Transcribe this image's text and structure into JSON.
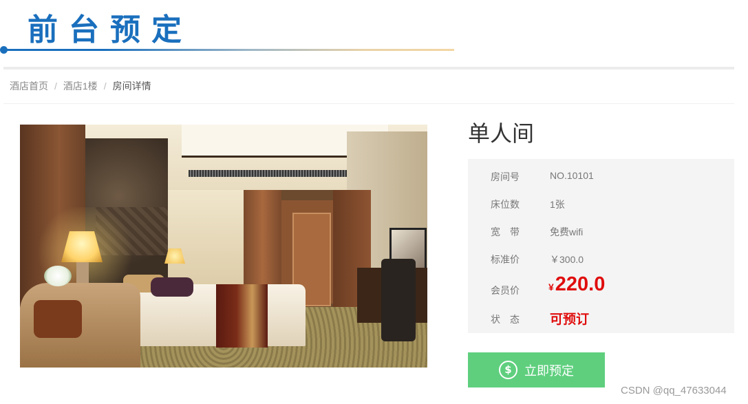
{
  "header": {
    "title": "前台预定"
  },
  "breadcrumb": {
    "home": "酒店首页",
    "floor": "酒店1楼",
    "current": "房间详情",
    "separator": "/"
  },
  "room": {
    "name": "单人间",
    "details": {
      "room_number": {
        "label": "房间号",
        "value": "NO.10101"
      },
      "beds": {
        "label": "床位数",
        "value": "1张"
      },
      "broadband": {
        "label": "宽　带",
        "value": "免费wifi"
      },
      "standard_price": {
        "label": "标准价",
        "value": "￥300.0"
      },
      "member_price": {
        "label": "会员价",
        "currency": "¥",
        "value": "220.0"
      },
      "status": {
        "label": "状　态",
        "value": "可预订"
      }
    }
  },
  "actions": {
    "book_label": "立即预定",
    "book_icon": "dollar-circle-icon"
  },
  "watermark": "CSDN @qq_47633044",
  "colors": {
    "brand_blue": "#1a6fbd",
    "price_red": "#e00d0d",
    "button_green": "#5fcf7e"
  }
}
